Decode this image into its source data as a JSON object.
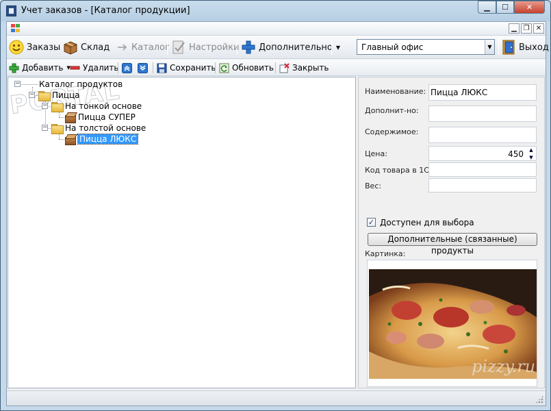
{
  "window": {
    "title": "Учет заказов - [Каталог продукции]",
    "watermark": "PORTAL"
  },
  "toolbar": {
    "orders": "Заказы",
    "warehouse": "Склад",
    "catalog": "Каталог",
    "settings": "Настройки",
    "additional": "Дополнительно",
    "office": "Главный офис",
    "exit": "Выход"
  },
  "actions": {
    "add": "Добавить",
    "delete": "Удалить",
    "save": "Сохранить",
    "refresh": "Обновить",
    "close": "Закрыть"
  },
  "tree": {
    "root": "Каталог продуктов",
    "pizza": "Пицца",
    "thin": "На тонкой основе",
    "super": "Пицца СУПЕР",
    "thick": "На толстой основе",
    "lux": "Пицца ЛЮКС"
  },
  "form": {
    "name_label": "Наименование:",
    "name_value": "Пицца ЛЮКС",
    "extra_label": "Дополнит-но:",
    "extra_value": "",
    "contents_label": "Содержимое:",
    "contents_value": "",
    "price_label": "Цена:",
    "price_value": "450",
    "code_label": "Код товара в 1С:",
    "code_value": "",
    "weight_label": "Вес:",
    "weight_value": "",
    "available_label": "Доступен для выбора",
    "available_checked": true,
    "related_button": "Дополнительные (связанные) продукты",
    "picture_label": "Картинка:",
    "picture_watermark": "pizzy.ru"
  }
}
